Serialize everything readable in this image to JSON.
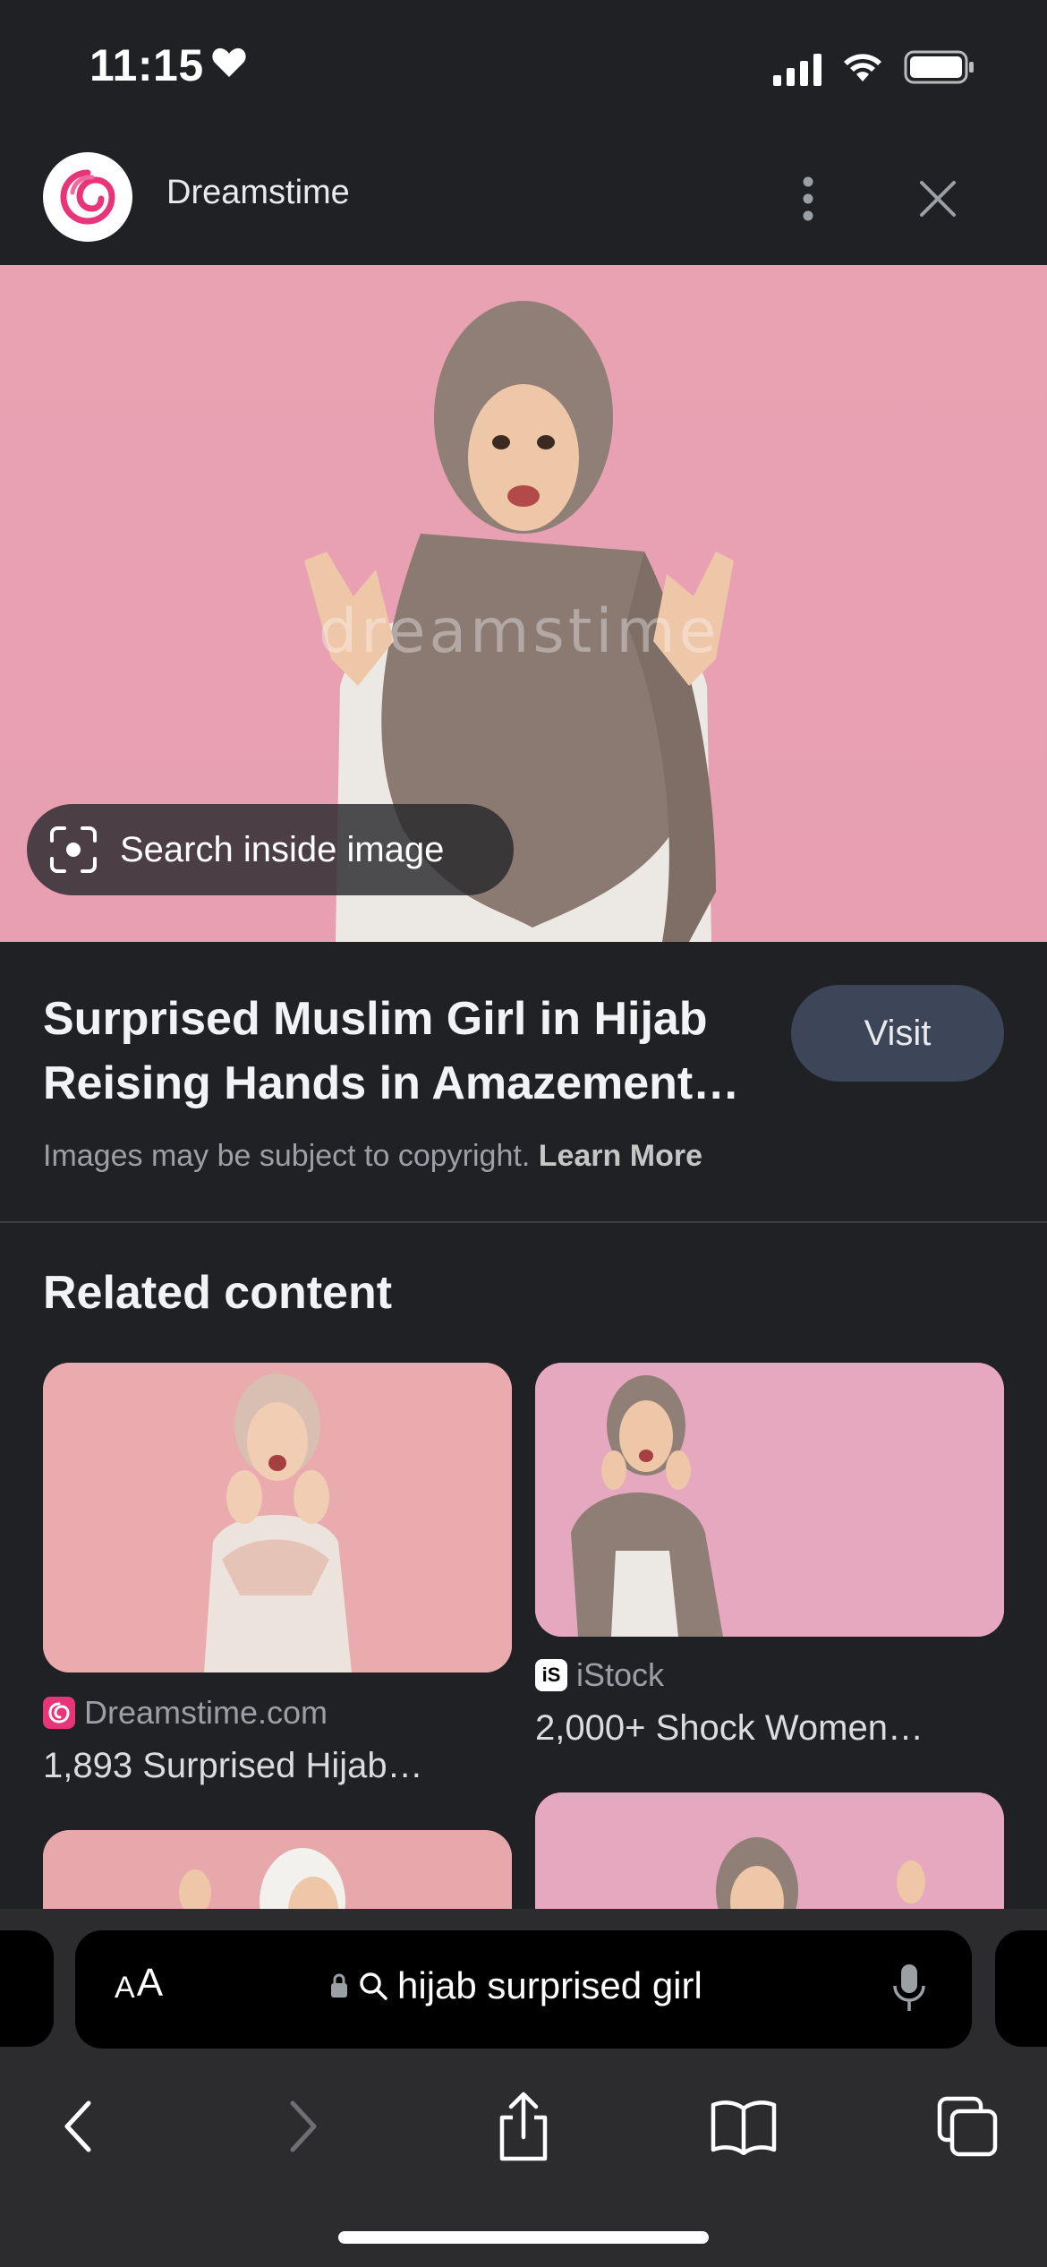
{
  "status_bar": {
    "time": "11:15"
  },
  "source": {
    "name": "Dreamstime"
  },
  "hero": {
    "watermark": "dreamstime",
    "search_inside_label": "Search inside image"
  },
  "result": {
    "title": "Surprised Muslim Girl in Hijab Reising Hands in Amazement…",
    "visit_label": "Visit",
    "copyright_text": "Images may be subject to copyright.",
    "learn_more_label": "Learn More"
  },
  "related": {
    "heading": "Related content",
    "cards": [
      {
        "source": "Dreamstime.com",
        "title": "1,893 Surprised Hijab…"
      },
      {
        "source": "iStock",
        "title": "2,000+ Shock Women…"
      },
      {
        "source": "",
        "title": ""
      },
      {
        "source": "",
        "title": ""
      }
    ]
  },
  "browser": {
    "aa_label_small": "A",
    "aa_label_large": "A",
    "address": "hijab surprised girl"
  },
  "colors": {
    "background": "#202124",
    "hero_pink": "#e8a2b2",
    "visit_button": "#3c4658",
    "dreamstime_brand": "#e8357a"
  },
  "icons": [
    "heart-icon",
    "signal-icon",
    "wifi-icon",
    "battery-icon",
    "dreamstime-logo",
    "more-vert-icon",
    "close-icon",
    "lens-icon",
    "lock-icon",
    "search-icon",
    "mic-icon",
    "back-icon",
    "forward-icon",
    "share-icon",
    "bookmarks-icon",
    "tabs-icon"
  ]
}
